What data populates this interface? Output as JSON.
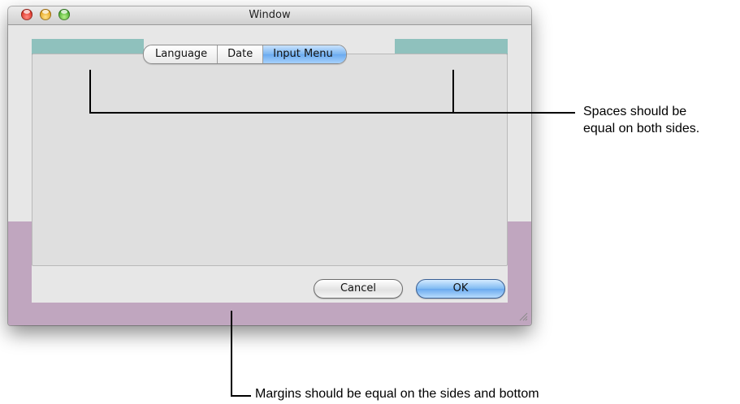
{
  "window": {
    "title": "Window"
  },
  "tabs": [
    {
      "label": "Language",
      "selected": false
    },
    {
      "label": "Date",
      "selected": false
    },
    {
      "label": "Input Menu",
      "selected": true
    }
  ],
  "buttons": {
    "cancel_label": "Cancel",
    "ok_label": "OK"
  },
  "annotations": {
    "spaces_line1": "Spaces should be",
    "spaces_line2": "equal on both sides.",
    "margins": "Margins should be equal on the sides and bottom"
  },
  "colors": {
    "spacing_highlight": "#8fc1bd",
    "margin_highlight": "#c0a6bf",
    "selected_tab": "#79b4f0",
    "window_background": "#e7e7e7"
  }
}
